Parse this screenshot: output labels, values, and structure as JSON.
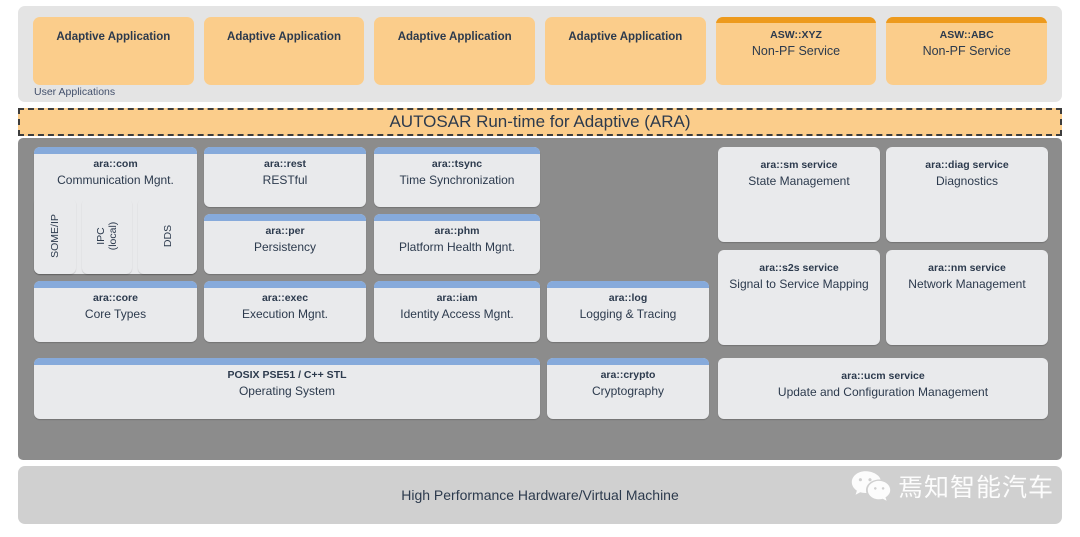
{
  "user_applications": {
    "caption": "User Applications",
    "boxes": [
      {
        "type": "adaptive",
        "label": "Adaptive Application"
      },
      {
        "type": "adaptive",
        "label": "Adaptive Application"
      },
      {
        "type": "adaptive",
        "label": "Adaptive Application"
      },
      {
        "type": "adaptive",
        "label": "Adaptive Application"
      },
      {
        "type": "nonpf",
        "title": "ASW::XYZ",
        "subtitle": "Non-PF Service"
      },
      {
        "type": "nonpf",
        "title": "ASW::ABC",
        "subtitle": "Non-PF Service"
      }
    ]
  },
  "ara_banner": {
    "label": "AUTOSAR Run-time for Adaptive (ARA)"
  },
  "platform": {
    "functional_clusters": [
      {
        "id": "com",
        "title": "ara::com",
        "subtitle": "Communication Mgnt."
      },
      {
        "id": "rest",
        "title": "ara::rest",
        "subtitle": "RESTful"
      },
      {
        "id": "tsync",
        "title": "ara::tsync",
        "subtitle": "Time Synchronization"
      },
      {
        "id": "per",
        "title": "ara::per",
        "subtitle": "Persistency"
      },
      {
        "id": "phm",
        "title": "ara::phm",
        "subtitle": "Platform Health Mgnt."
      },
      {
        "id": "core",
        "title": "ara::core",
        "subtitle": "Core Types"
      },
      {
        "id": "exec",
        "title": "ara::exec",
        "subtitle": "Execution Mgnt."
      },
      {
        "id": "iam",
        "title": "ara::iam",
        "subtitle": "Identity Access Mgnt."
      },
      {
        "id": "log",
        "title": "ara::log",
        "subtitle": "Logging & Tracing"
      },
      {
        "id": "posix",
        "title": "POSIX PSE51 / C++ STL",
        "subtitle": "Operating System"
      },
      {
        "id": "crypto",
        "title": "ara::crypto",
        "subtitle": "Cryptography"
      }
    ],
    "com_bindings": [
      {
        "id": "someip",
        "label": "SOME/IP"
      },
      {
        "id": "ipc",
        "label": "IPC",
        "label2": "(local)"
      },
      {
        "id": "dds",
        "label": "DDS"
      }
    ],
    "services": [
      {
        "id": "sm",
        "title": "ara::sm service",
        "subtitle": "State Management"
      },
      {
        "id": "diag",
        "title": "ara::diag service",
        "subtitle": "Diagnostics"
      },
      {
        "id": "s2s",
        "title": "ara::s2s service",
        "subtitle": "Signal to Service Mapping"
      },
      {
        "id": "nm",
        "title": "ara::nm service",
        "subtitle": "Network Management"
      },
      {
        "id": "ucm",
        "title": "ara::ucm service",
        "subtitle": "Update and Configuration Management"
      }
    ]
  },
  "hardware": {
    "label": "High Performance Hardware/Virtual Machine"
  },
  "watermark": {
    "icon": "wechat-icon",
    "text": "焉知智能汽车"
  },
  "colors": {
    "application_fill": "#fbcd8b",
    "nonpf_top_bar": "#ed9a1d",
    "ara_banner_fill": "#fbcd8b",
    "platform_fill": "#8c8c8c",
    "module_fill": "#e9eaec",
    "module_top_bar": "#86aadb",
    "hardware_fill": "#d0d0d0",
    "text": "#2c3a4d"
  }
}
